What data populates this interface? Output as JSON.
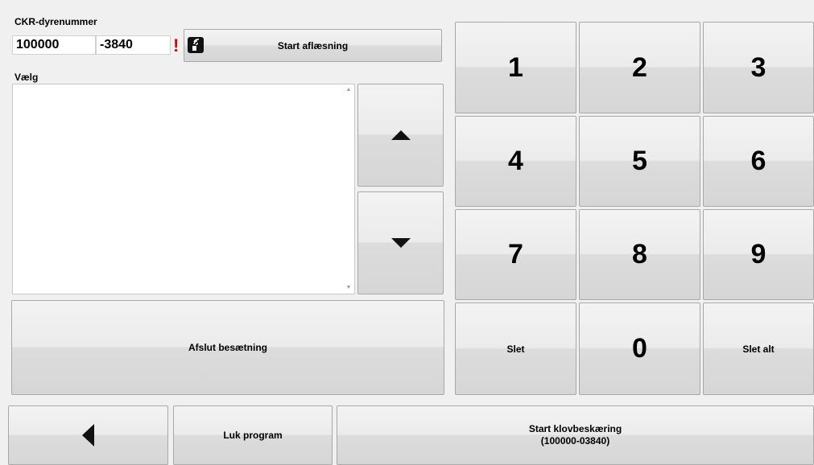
{
  "animal": {
    "label": "CKR-dyrenummer",
    "herd_number": "100000",
    "animal_number": "-3840",
    "warning": "!"
  },
  "reading": {
    "start_label": "Start aflæsning",
    "icon": "rfid-reader-icon"
  },
  "selection": {
    "label": "Vælg",
    "items": []
  },
  "keypad": {
    "keys": [
      "1",
      "2",
      "3",
      "4",
      "5",
      "6",
      "7",
      "8",
      "9",
      "Slet",
      "0",
      "Slet alt"
    ]
  },
  "actions": {
    "finish_label": "Afslut besætning",
    "close_label": "Luk program",
    "start_trim_label": "Start klovbeskæring",
    "start_trim_id": "(100000-03840)"
  }
}
